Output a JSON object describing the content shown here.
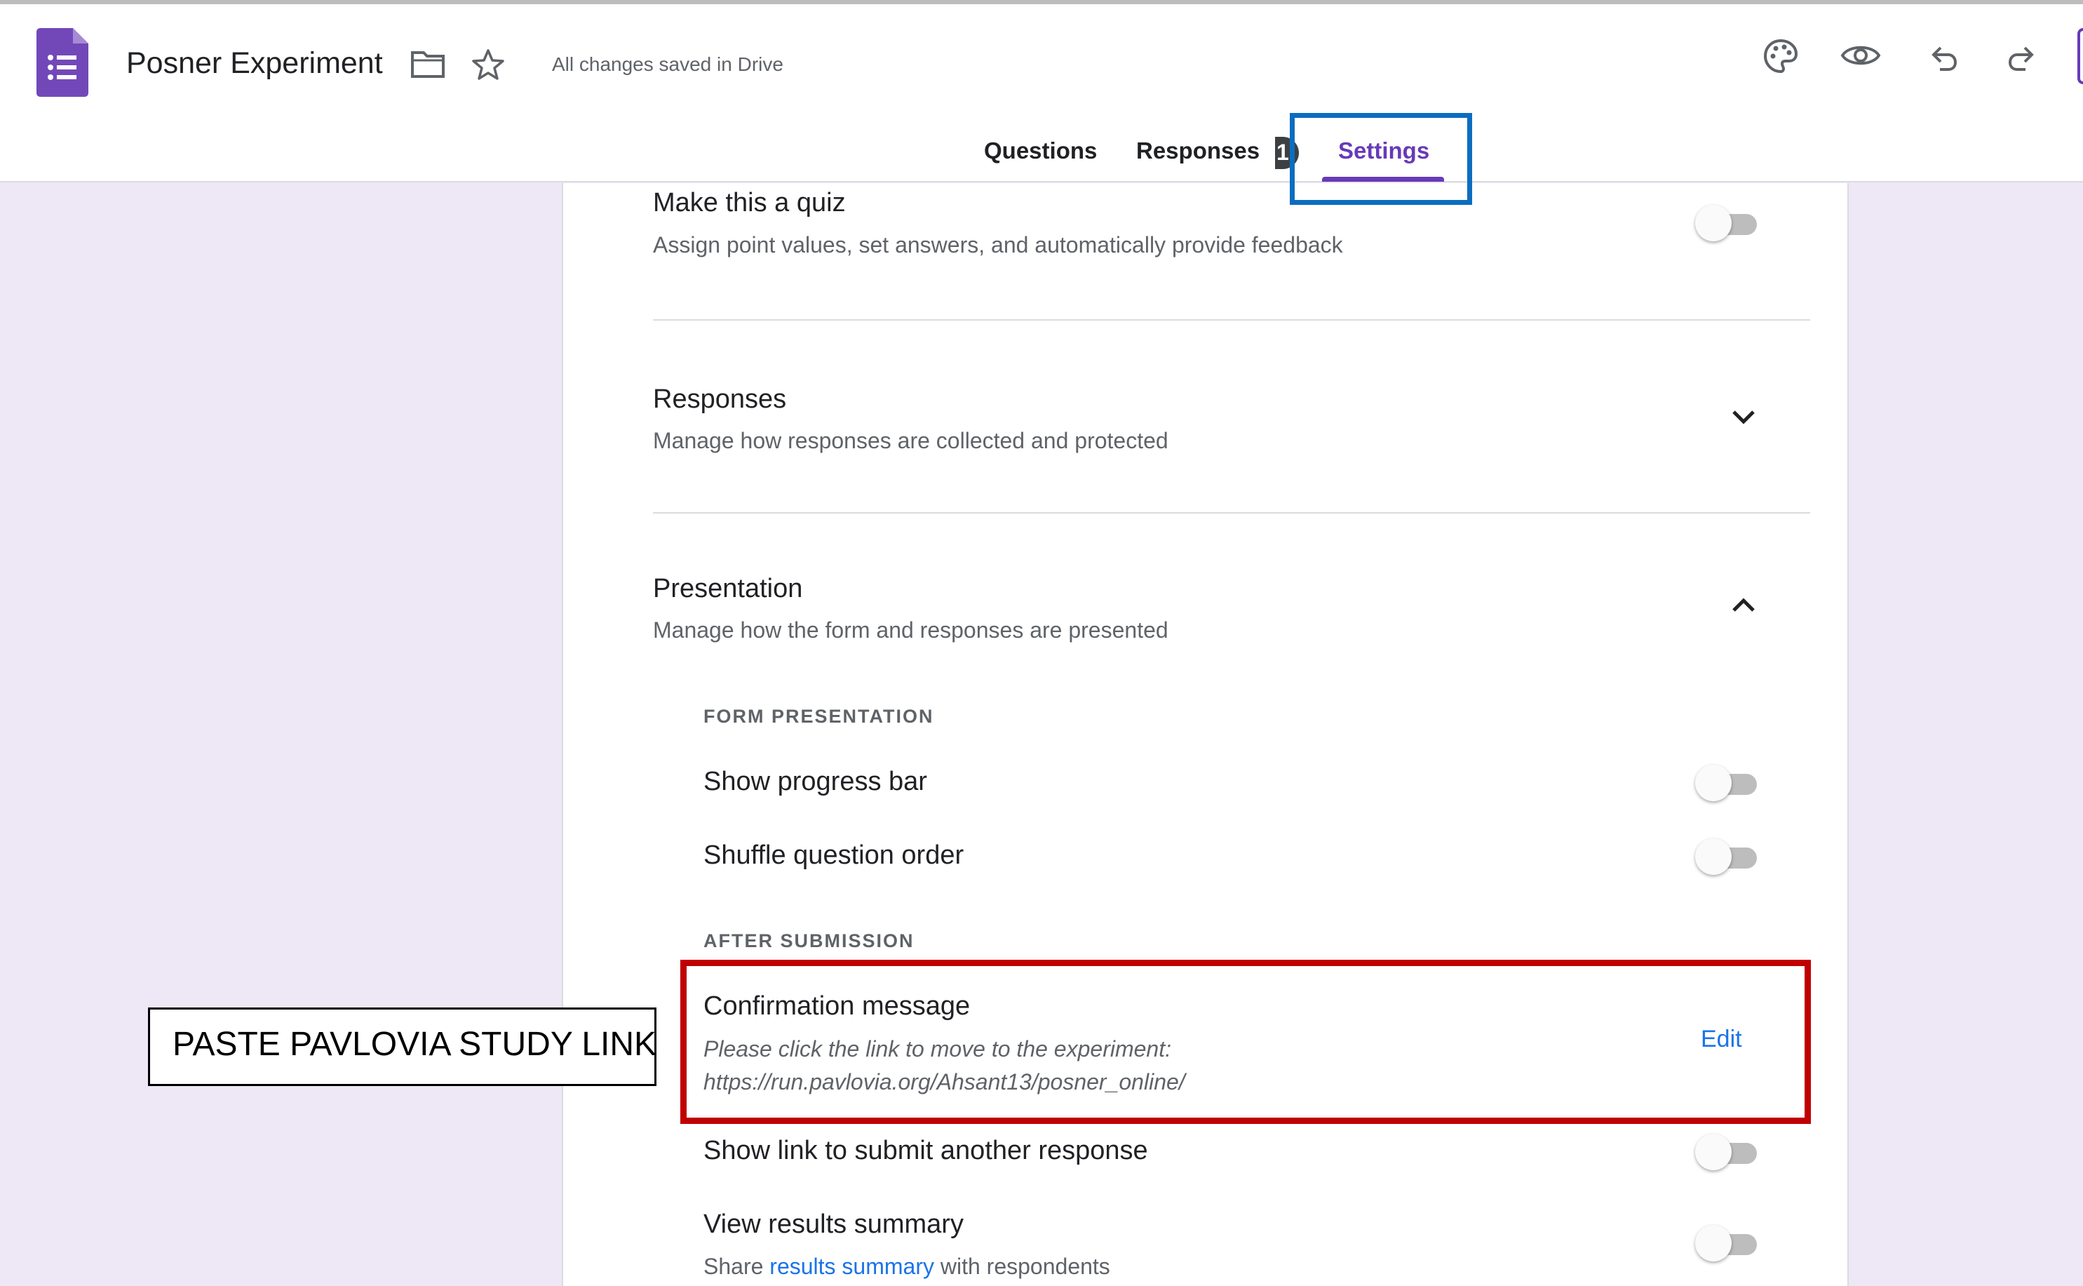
{
  "header": {
    "doc_title": "Posner Experiment",
    "save_status": "All changes saved in Drive",
    "icons": [
      "forms-logo-icon",
      "folder-icon",
      "star-icon",
      "palette-icon",
      "preview-eye-icon",
      "undo-icon",
      "redo-icon"
    ]
  },
  "tabs": [
    {
      "label": "Questions",
      "active": false
    },
    {
      "label": "Responses",
      "active": false,
      "badge": "1"
    },
    {
      "label": "Settings",
      "active": true
    }
  ],
  "settings": {
    "quiz": {
      "title": "Make this a quiz",
      "description": "Assign point values, set answers, and automatically provide feedback",
      "enabled": false
    },
    "responses": {
      "title": "Responses",
      "description": "Manage how responses are collected and protected",
      "expanded": false
    },
    "presentation": {
      "title": "Presentation",
      "description": "Manage how the form and responses are presented",
      "expanded": true,
      "form_presentation_header": "FORM PRESENTATION",
      "progress_bar": {
        "label": "Show progress bar",
        "enabled": false
      },
      "shuffle": {
        "label": "Shuffle question order",
        "enabled": false
      },
      "after_submission_header": "AFTER SUBMISSION",
      "confirmation": {
        "label": "Confirmation message",
        "message_line1": "Please click the link to move to the experiment:",
        "message_line2": "https://run.pavlovia.org/Ahsant13/posner_online/",
        "edit_label": "Edit"
      },
      "submit_another": {
        "label": "Show link to submit another response",
        "enabled": false
      },
      "results_summary": {
        "label": "View results summary",
        "desc_prefix": "Share",
        "desc_link": "results summary",
        "desc_suffix": "with respondents",
        "enabled": false
      }
    }
  },
  "annotation": {
    "callout": "PASTE PAVLOVIA STUDY LINK"
  },
  "colors": {
    "accent": "#673ab7",
    "background": "#ede7f6",
    "link": "#1a73e8",
    "highlight_blue": "#0b6dbf",
    "highlight_red": "#c00000"
  }
}
